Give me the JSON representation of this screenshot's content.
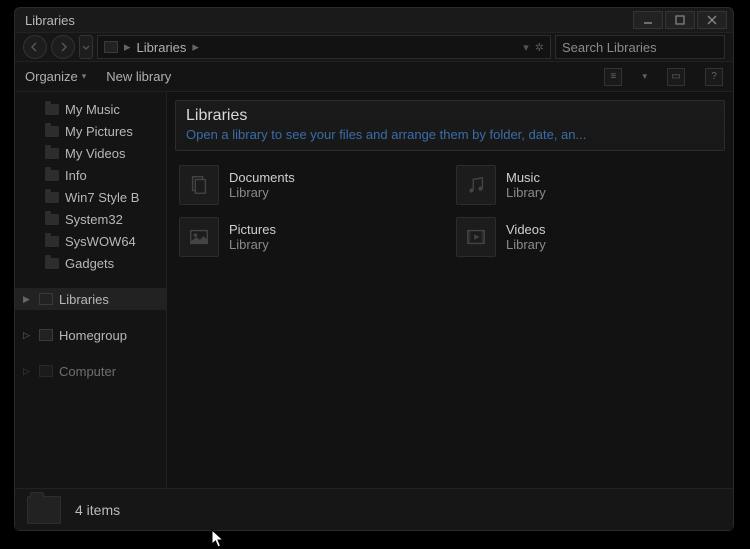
{
  "window": {
    "title": "Libraries"
  },
  "nav": {
    "breadcrumb_root": "Libraries",
    "search_placeholder": "Search Libraries"
  },
  "toolbar": {
    "organize": "Organize",
    "new_library": "New library"
  },
  "sidebar": {
    "items": [
      {
        "label": "My Music"
      },
      {
        "label": "My Pictures"
      },
      {
        "label": "My Videos"
      },
      {
        "label": "Info"
      },
      {
        "label": "Win7 Style B"
      },
      {
        "label": "System32"
      },
      {
        "label": "SysWOW64"
      },
      {
        "label": "Gadgets"
      }
    ],
    "groups": [
      {
        "label": "Libraries",
        "selected": true
      },
      {
        "label": "Homegroup",
        "selected": false
      },
      {
        "label": "Computer",
        "selected": false
      }
    ]
  },
  "content": {
    "heading": "Libraries",
    "subheading": "Open a library to see your files and arrange them by folder, date, an...",
    "items": [
      {
        "name": "Documents",
        "sub": "Library",
        "icon": "documents"
      },
      {
        "name": "Music",
        "sub": "Library",
        "icon": "music"
      },
      {
        "name": "Pictures",
        "sub": "Library",
        "icon": "pictures"
      },
      {
        "name": "Videos",
        "sub": "Library",
        "icon": "videos"
      }
    ]
  },
  "status": {
    "text": "4 items"
  }
}
